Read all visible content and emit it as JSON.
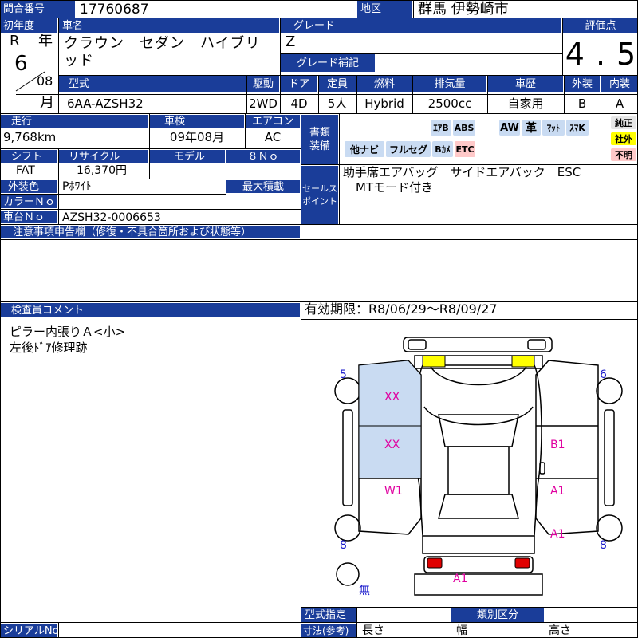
{
  "header": {
    "inquiry_label": "問合番号",
    "inquiry_no": "17760687",
    "region_label": "地区",
    "region": "群馬 伊勢崎市"
  },
  "car": {
    "first_reg_label": "初年度",
    "era": "R",
    "year_suffix": "年",
    "year": "6",
    "month": "08",
    "month_suffix": "月",
    "name_label": "車名",
    "name": "クラウン　セダン　ハイブリッド",
    "grade_label": "グレード",
    "grade": "Z",
    "grade_sup_label": "グレード補記",
    "grade_sup": "",
    "score_label": "評価点",
    "score": "4.5",
    "model_label": "型式",
    "model": "6AA-AZSH32",
    "drive_label": "駆動",
    "drive": "2WD",
    "door_label": "ドア",
    "door": "4D",
    "capacity_label": "定員",
    "capacity": "5人",
    "fuel_label": "燃料",
    "fuel": "Hybrid",
    "displacement_label": "排気量",
    "displacement": "2500cc",
    "history_label": "車歴",
    "history": "自家用",
    "exterior_label": "外装",
    "exterior": "B",
    "interior_label": "内装",
    "interior": "A"
  },
  "row3": {
    "mileage_label": "走行",
    "mileage": "9,768km",
    "inspection_label": "車検",
    "inspection": "09年08月",
    "ac_label": "エアコン",
    "ac": "AC",
    "shift_label": "シフト",
    "shift": "FAT",
    "recycle_label": "リサイクル",
    "recycle": "16,370円",
    "model_year_label": "モデル",
    "model_year": "",
    "eight_no_label": "８Ｎｏ",
    "eight_no": "",
    "color_label": "外装色",
    "color": "Pﾎﾜｲﾄ",
    "max_load_label": "最大積載",
    "max_load": "",
    "color_no_label": "カラーＮｏ",
    "color_no": "",
    "chassis_label": "車台Ｎｏ",
    "chassis": "AZSH32-0006653",
    "notes_label": "注意事項申告欄（修復・不具合箇所および状態等）"
  },
  "equipment": {
    "label": "書類\n装備",
    "items_row1": [
      "ｴｱB",
      "ABS",
      "AW",
      "革",
      "ﾏｯﾄ",
      "ｽﾏK"
    ],
    "items_row2": [
      "他ナビ",
      "フルセグ",
      "Bｶﾒ",
      "ETC"
    ],
    "status": [
      "純正",
      "社外",
      "不明"
    ]
  },
  "sales_point": {
    "label": "セールス\nポイント",
    "line1": "助手席エアバッグ　サイドエアバック　ESC",
    "line2": "MTモード付き"
  },
  "inspector": {
    "label": "検査員コメント",
    "line1": "ピラー内張りＡ<小>",
    "line2": "左後ﾄﾞｱ修理跡"
  },
  "validity": "有効期限：R8/06/29～R8/09/27",
  "diagram": {
    "marks": [
      "XX",
      "XX",
      "W1",
      "B1",
      "A1",
      "A1",
      "A1"
    ],
    "side_numbers": [
      "5",
      "6",
      "8",
      "8"
    ],
    "none_label": "無"
  },
  "footer": {
    "serial_label": "シリアルNo",
    "type_designation_label": "型式指定",
    "class_label": "類別区分",
    "dimension_label": "寸法(参考)",
    "length_label": "長さ",
    "width_label": "幅",
    "height_label": "高さ"
  }
}
